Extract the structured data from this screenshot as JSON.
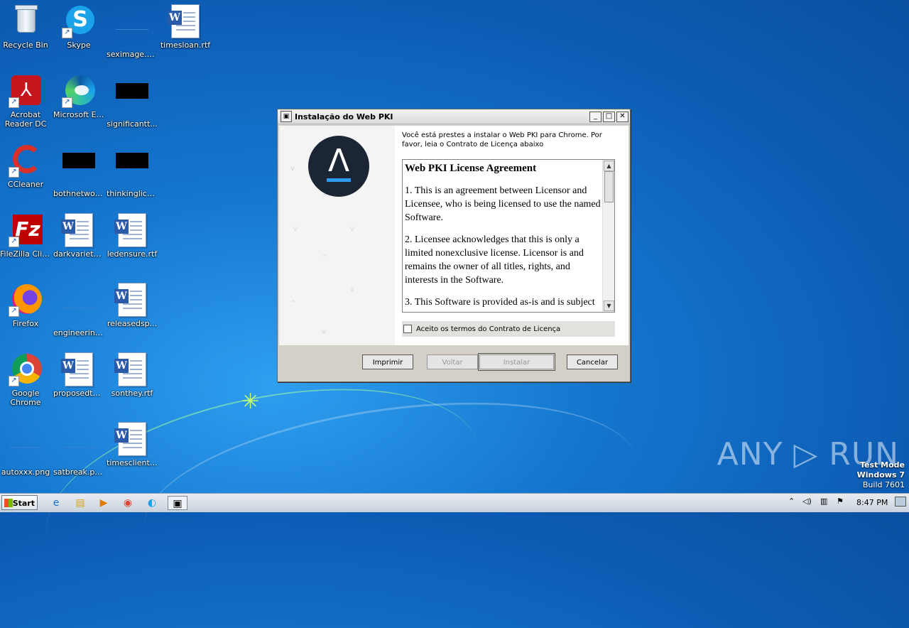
{
  "desktop": {
    "icons": [
      {
        "label": "Recycle Bin",
        "icon": "recycle-bin-icon"
      },
      {
        "label": "Skype",
        "icon": "skype-icon"
      },
      {
        "label": "seximage.png",
        "icon": "png-file-icon"
      },
      {
        "label": "timesloan.rtf",
        "icon": "word-doc-icon"
      },
      {
        "label": "Acrobat Reader DC",
        "icon": "acrobat-icon"
      },
      {
        "label": "Microsoft Edge",
        "icon": "edge-icon"
      },
      {
        "label": "significantt...",
        "icon": "black-file-icon"
      },
      {
        "label": "CCleaner",
        "icon": "ccleaner-icon"
      },
      {
        "label": "bothnetwor...",
        "icon": "black-file-icon"
      },
      {
        "label": "thinkinglice...",
        "icon": "black-file-icon"
      },
      {
        "label": "FileZilla Client",
        "icon": "filezilla-icon"
      },
      {
        "label": "darkvariety.rtf",
        "icon": "word-doc-icon"
      },
      {
        "label": "ledensure.rtf",
        "icon": "word-doc-icon"
      },
      {
        "label": "Firefox",
        "icon": "firefox-icon"
      },
      {
        "label": "engineering....",
        "icon": "png-file-icon"
      },
      {
        "label": "releasedsp...",
        "icon": "word-doc-icon"
      },
      {
        "label": "Google Chrome",
        "icon": "chrome-icon"
      },
      {
        "label": "proposedtell...",
        "icon": "word-doc-icon"
      },
      {
        "label": "sonthey.rtf",
        "icon": "word-doc-icon"
      },
      {
        "label": "timesclients.rtf",
        "icon": "word-doc-icon"
      },
      {
        "label": "autoxxx.png",
        "icon": "png-file-icon"
      },
      {
        "label": "satbreak.png",
        "icon": "png-file-icon"
      }
    ]
  },
  "dialog": {
    "title": "Instalação do Web PKI",
    "intro": "Você está prestes a instalar o Web PKI para Chrome. Por favor, leia o Contrato de Licença abaixo",
    "license": {
      "heading": "Web PKI License Agreement",
      "p1": "1. This is an agreement between Licensor and Licensee, who is being licensed to use the named Software.",
      "p2": "2. Licensee acknowledges that this is only a limited nonexclusive license. Licensor is and remains the owner of all titles, rights, and interests in the Software.",
      "p3": "3. This Software is provided as-is and is subject"
    },
    "accept_label": "Aceito os termos do Contrato de Licença",
    "buttons": {
      "print": "Imprimir",
      "back": "Voltar",
      "install": "Instalar",
      "cancel": "Cancelar"
    }
  },
  "watermark": "ANY ▷ RUN",
  "test_mode": {
    "line1": "Test Mode",
    "line2": "Windows 7",
    "line3": "Build 7601"
  },
  "taskbar": {
    "start_label": "Start",
    "clock": "8:47 PM"
  }
}
